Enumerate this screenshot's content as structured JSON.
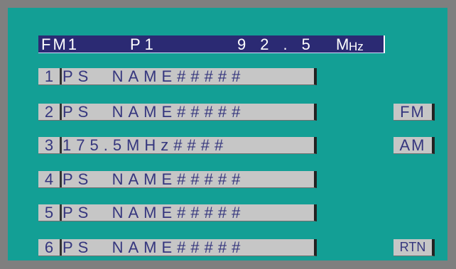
{
  "header": {
    "band": "FM1",
    "preset": "P1",
    "frequency": "92.5",
    "unit_m": "M",
    "unit_hz": "Hz"
  },
  "presets": [
    {
      "num": "1",
      "name": "PS  NAME#####"
    },
    {
      "num": "2",
      "name": "PS  NAME#####"
    },
    {
      "num": "3",
      "name": "175.5MHz####"
    },
    {
      "num": "4",
      "name": "PS  NAME#####"
    },
    {
      "num": "5",
      "name": "PS  NAME#####"
    },
    {
      "num": "6",
      "name": "PS  NAME#####"
    }
  ],
  "buttons": {
    "fm": "FM",
    "am": "AM",
    "rtn": "RTN"
  },
  "colors": {
    "background_outer": "#7f7f7f",
    "screen": "#139f95",
    "header_bg": "#2b2a73",
    "header_text": "#ffffff",
    "button_bg": "#c6c6c6",
    "button_text": "#35367e"
  }
}
